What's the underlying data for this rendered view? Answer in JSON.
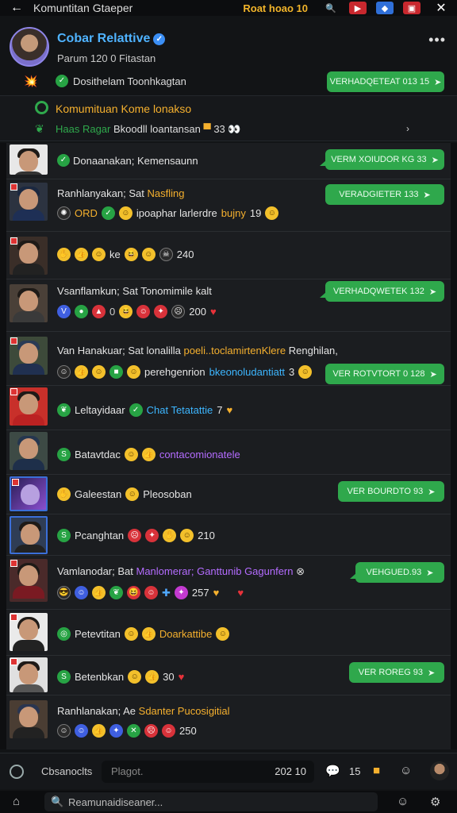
{
  "topbar": {
    "back_icon": "arrow-left-icon",
    "title": "Komuntitan Gtaeper",
    "badge": "Roat hoao 10",
    "close_icon": "close-icon"
  },
  "profile": {
    "name": "Cobar Relattive",
    "subtitle": "Parum 120 0 Fitastan",
    "more": "•••",
    "row2_label": "Dosithelam Toonhkagtan",
    "row2_pill": "VERHADQETEAT 013 15"
  },
  "pinned": {
    "title": "Komumituan Kome lonakso",
    "sub_green": "Haas Ragar",
    "sub_text": "Bkoodll loantansan",
    "sub_count": "33"
  },
  "rows": [
    {
      "id": 0,
      "line1": "Donaanakan; Kemensaunn",
      "pill": "VERM XOIUDOR KG 33"
    },
    {
      "id": 1,
      "line1": "Ranhlanyakan; Sat",
      "line1_hl": "Nasfling",
      "line2_prefix": "ORD",
      "line2_text": "ipoaphar larlerdre",
      "line2_hl": "bujny",
      "line2_count": "19",
      "pill": "VERADGIETER 133"
    },
    {
      "id": 2,
      "line1": "ke",
      "line1_count": "240"
    },
    {
      "id": 3,
      "line1": "Vsanflamkun; Sat",
      "line1_hl": "Tonomimile kalt",
      "line1_count": "200",
      "pill": "VERHADQWETEK 132"
    },
    {
      "id": 4,
      "line1": "Van Hanakuar; Sat lonalilla",
      "line1_hl": "poeli..toclamirtenKlere",
      "line1_tail": "Renghilan,",
      "line2_text": "perehgenrion",
      "line2_hl": "bkeonoludantiatt",
      "line2_count": "3",
      "pill": "VER ROTVTORT 0 128"
    },
    {
      "id": 5,
      "line1": "Leltayidaar",
      "line1_hl": "Chat Tetatattie",
      "line1_tail": "7"
    },
    {
      "id": 6,
      "line1": "Batavtdac",
      "line1_hl": "contacomionatele"
    },
    {
      "id": 7,
      "line1": "Galeestan",
      "line1_tail": "Pleosoban",
      "pill": "VER BOURDTO 93"
    },
    {
      "id": 8,
      "line1": "Pcanghtan",
      "line1_count": "210"
    },
    {
      "id": 9,
      "line1": "Vamlanodar; Bat",
      "line1_hl": "Manlomerar; Ganttunib Gagunfern",
      "line2_count": "257",
      "pill": "VEHGUED.93"
    },
    {
      "id": 10,
      "line1": "Petevtitan",
      "line1_hl": "Doarkattibe"
    },
    {
      "id": 11,
      "line1": "Betenbkan",
      "line1_count": "30",
      "pill": "VER ROREG 93"
    },
    {
      "id": 12,
      "line1": "Ranhlanakan; Ae",
      "line1_hl": "Sdanter Pucosigitial",
      "line2_count": "250"
    }
  ],
  "composer": {
    "label": "Cbsanoclts",
    "placeholder": "Plagot.",
    "counter": "202 10",
    "count2": "15"
  },
  "bottombar": {
    "search_placeholder": "Reamunaidiseaner..."
  },
  "colors": {
    "accent_green": "#2fa84c",
    "accent_blue": "#3db6ff",
    "accent_orange": "#f5b02e",
    "background": "#1b1d20"
  }
}
